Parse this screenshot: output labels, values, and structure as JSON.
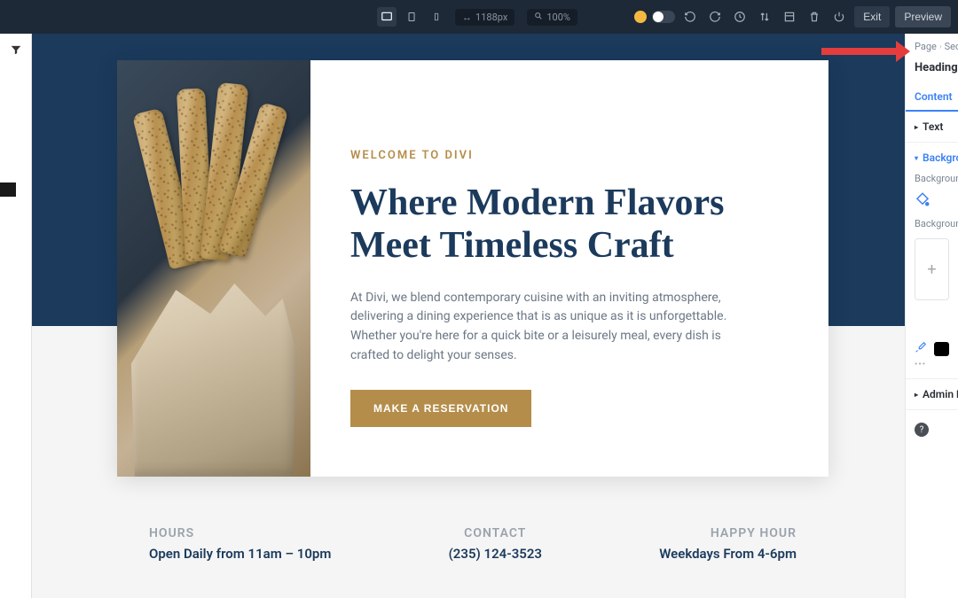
{
  "topbar": {
    "width_value": "1188px",
    "zoom_value": "100%",
    "exit_label": "Exit",
    "preview_label": "Preview"
  },
  "breadcrumb": {
    "page": "Page",
    "section": "Sec"
  },
  "panel": {
    "title": "Heading",
    "tab_content": "Content",
    "section_text": "Text",
    "section_background": "Background",
    "bg_label": "Background",
    "bg_label2": "Background",
    "admin_label": "Admin Label"
  },
  "hero": {
    "eyebrow": "WELCOME TO DIVI",
    "headline": "Where Modern Flavors Meet Timeless Craft",
    "body": "At Divi, we blend contemporary cuisine with an inviting atmosphere, delivering a dining experience that is as unique as it is unforgettable. Whether you're here for a quick bite or a leisurely meal, every dish is crafted to delight your senses.",
    "cta": "MAKE A RESERVATION"
  },
  "info": {
    "hours_label": "HOURS",
    "hours_value": "Open Daily from 11am – 10pm",
    "contact_label": "CONTACT",
    "contact_value": "(235) 124-3523",
    "happy_label": "HAPPY HOUR",
    "happy_value": "Weekdays From 4-6pm"
  }
}
